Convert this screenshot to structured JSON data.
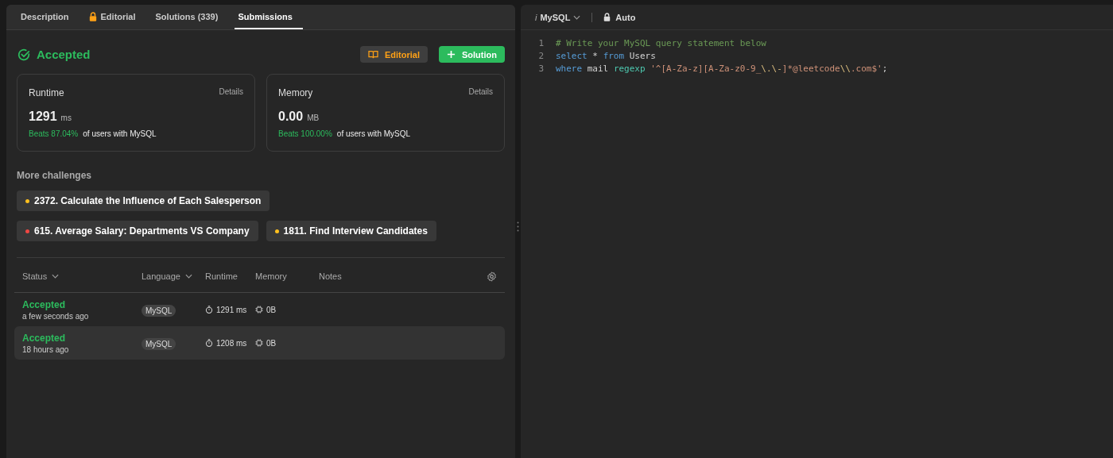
{
  "left_panel": {
    "tabs": [
      {
        "label": "Description",
        "selected": false,
        "locked": false
      },
      {
        "label": "Editorial",
        "selected": false,
        "locked": true
      },
      {
        "label": "Solutions (339)",
        "selected": false,
        "locked": false
      },
      {
        "label": "Submissions",
        "selected": true,
        "locked": false
      }
    ],
    "result": {
      "status": "Accepted",
      "editorial_button": "Editorial",
      "solution_button": "Solution"
    },
    "stats": [
      {
        "title": "Runtime",
        "details": "Details",
        "value": "1291",
        "unit": "ms",
        "beats": "Beats 87.04%",
        "beats_suffix": "of users with MySQL"
      },
      {
        "title": "Memory",
        "details": "Details",
        "value": "0.00",
        "unit": "MB",
        "beats": "Beats 100.00%",
        "beats_suffix": "of users with MySQL"
      }
    ],
    "more_challenges": {
      "heading": "More challenges",
      "rows": [
        [
          {
            "label": "2372. Calculate the Influence of Each Salesperson",
            "color": "#ffc01e"
          }
        ],
        [
          {
            "label": "615. Average Salary: Departments VS Company",
            "color": "#ef4743"
          },
          {
            "label": "1811. Find Interview Candidates",
            "color": "#ffc01e"
          }
        ]
      ]
    },
    "table": {
      "columns": [
        {
          "label": "Status",
          "sortable": true
        },
        {
          "label": "Language",
          "sortable": true
        },
        {
          "label": "Runtime",
          "sortable": false
        },
        {
          "label": "Memory",
          "sortable": false
        },
        {
          "label": "Notes",
          "sortable": false
        }
      ],
      "rows": [
        {
          "status": "Accepted",
          "time": "a few seconds ago",
          "language": "MySQL",
          "runtime": "1291 ms",
          "memory": "0B",
          "selected": false
        },
        {
          "status": "Accepted",
          "time": "18 hours ago",
          "language": "MySQL",
          "runtime": "1208 ms",
          "memory": "0B",
          "selected": true
        }
      ]
    }
  },
  "editor": {
    "language_mark": "i",
    "language": "MySQL",
    "mode": "Auto",
    "lines": [
      {
        "number": "1",
        "tokens": [
          {
            "kind": "comment",
            "text": "# Write your MySQL query statement below"
          }
        ]
      },
      {
        "number": "2",
        "tokens": [
          {
            "kind": "keyword",
            "text": "select"
          },
          {
            "kind": "plain",
            "text": " * "
          },
          {
            "kind": "keyword",
            "text": "from"
          },
          {
            "kind": "plain",
            "text": " Users"
          }
        ]
      },
      {
        "number": "3",
        "tokens": [
          {
            "kind": "keyword",
            "text": "where"
          },
          {
            "kind": "plain",
            "text": " mail "
          },
          {
            "kind": "function",
            "text": "regexp"
          },
          {
            "kind": "string",
            "text": " '^[A-Za-z][A-Za-z0-9_"
          },
          {
            "kind": "escape",
            "text": "\\.\\-"
          },
          {
            "kind": "string",
            "text": "]*@leetcode"
          },
          {
            "kind": "escape",
            "text": "\\\\"
          },
          {
            "kind": "string",
            "text": ".com$'"
          },
          {
            "kind": "plain",
            "text": ";"
          }
        ]
      }
    ]
  }
}
